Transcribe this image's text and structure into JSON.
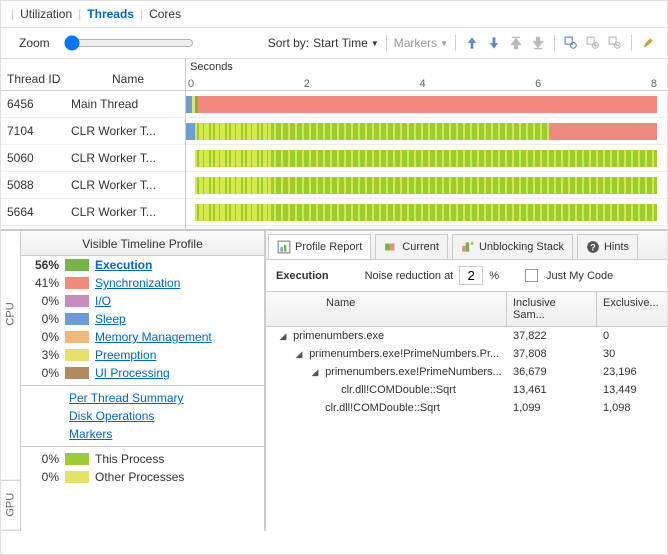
{
  "tabs": {
    "t0": "Utilization",
    "t1": "Threads",
    "t2": "Cores"
  },
  "toolbar": {
    "zoom": "Zoom",
    "sortby": "Sort by:",
    "sort_value": "Start Time",
    "markers": "Markers"
  },
  "timeline": {
    "seconds_label": "Seconds",
    "ticks": [
      "0",
      "2",
      "4",
      "6",
      "8"
    ],
    "header_id": "Thread ID",
    "header_name": "Name",
    "threads": [
      {
        "id": "6456",
        "name": "Main Thread"
      },
      {
        "id": "7104",
        "name": "CLR Worker T..."
      },
      {
        "id": "5060",
        "name": "CLR Worker T..."
      },
      {
        "id": "5088",
        "name": "CLR Worker T..."
      },
      {
        "id": "5664",
        "name": "CLR Worker T..."
      }
    ]
  },
  "profile": {
    "heading": "Visible Timeline Profile",
    "side0": "CPU",
    "side1": "",
    "side2": "GPU",
    "rows": [
      {
        "pct": "56%",
        "color": "#76b447",
        "label": "Execution",
        "bold": true
      },
      {
        "pct": "41%",
        "color": "#f08a7d",
        "label": "Synchronization"
      },
      {
        "pct": "0%",
        "color": "#c88bbd",
        "label": "I/O"
      },
      {
        "pct": "0%",
        "color": "#6a9ed4",
        "label": "Sleep"
      },
      {
        "pct": "0%",
        "color": "#f2b77b",
        "label": "Memory Management"
      },
      {
        "pct": "3%",
        "color": "#e4e26a",
        "label": "Preemption"
      },
      {
        "pct": "0%",
        "color": "#b08a5e",
        "label": "UI Processing"
      }
    ],
    "links": [
      "Per Thread Summary",
      "Disk Operations",
      "Markers"
    ],
    "gpu_rows": [
      {
        "pct": "0%",
        "color": "#9acd32",
        "label": "This Process"
      },
      {
        "pct": "0%",
        "color": "#e4e26a",
        "label": "Other Processes"
      }
    ]
  },
  "report": {
    "tabs": [
      "Profile Report",
      "Current",
      "Unblocking Stack",
      "Hints"
    ],
    "exec_label": "Execution",
    "noise_label": "Noise reduction at",
    "noise_val": "2",
    "pct": "%",
    "just_my_code": "Just My Code",
    "col_name": "Name",
    "col_incl": "Inclusive Sam...",
    "col_excl": "Exclusive...",
    "rows": [
      {
        "indent": 0,
        "exp": true,
        "name": "primenumbers.exe",
        "incl": "37,822",
        "excl": "0"
      },
      {
        "indent": 1,
        "exp": true,
        "name": "primenumbers.exe!PrimeNumbers.Pr...",
        "incl": "37,808",
        "excl": "30"
      },
      {
        "indent": 2,
        "exp": true,
        "name": "primenumbers.exe!PrimeNumbers...",
        "incl": "36,679",
        "excl": "23,196"
      },
      {
        "indent": 3,
        "exp": false,
        "name": "clr.dll!COMDouble::Sqrt",
        "incl": "13,461",
        "excl": "13,449"
      },
      {
        "indent": 2,
        "exp": false,
        "name": "clr.dll!COMDouble::Sqrt",
        "incl": "1,099",
        "excl": "1,098"
      }
    ]
  },
  "colors": {
    "green": "#76b447",
    "salmon": "#f08a7d",
    "yellow": "#e4e26a",
    "blue": "#6a9ed4"
  }
}
